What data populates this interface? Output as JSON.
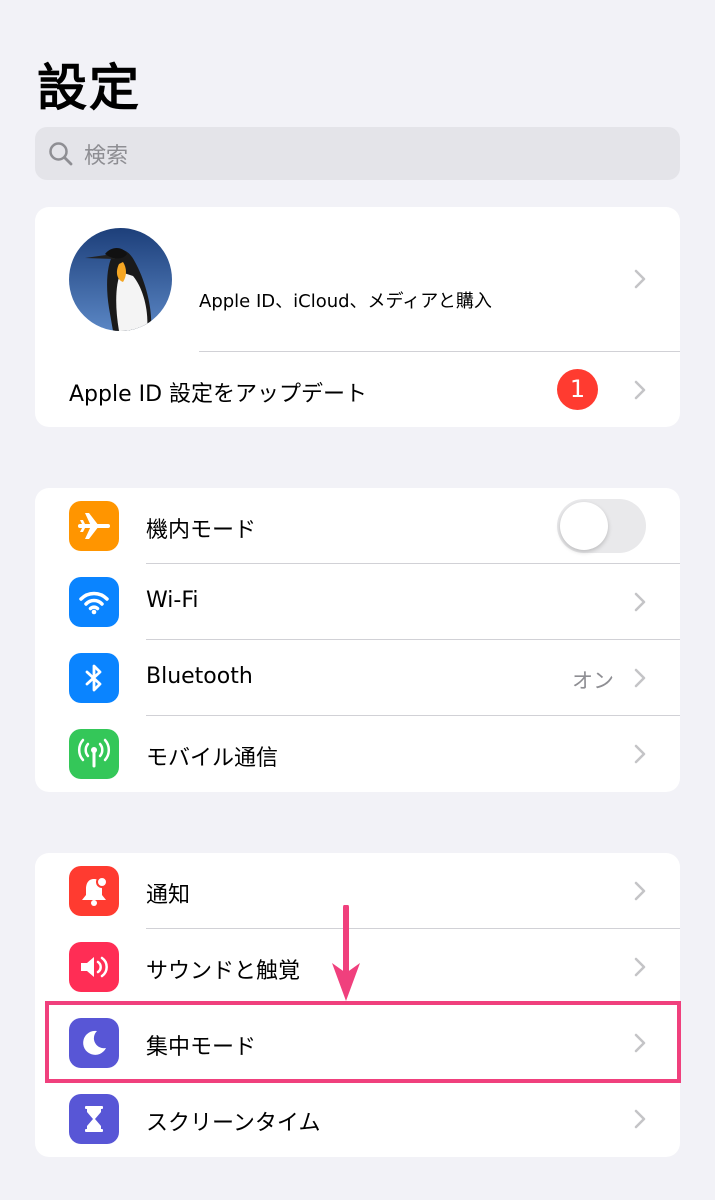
{
  "page": {
    "title": "設定"
  },
  "search": {
    "placeholder": "検索",
    "icon": "search-icon"
  },
  "profile": {
    "subtitle": "Apple ID、iCloud、メディアと購入",
    "update_label": "Apple ID 設定をアップデート",
    "badge_count": "1"
  },
  "network": {
    "items": [
      {
        "label": "機内モード",
        "icon": "airplane-icon",
        "color": "#ff9500",
        "toggle_on": false
      },
      {
        "label": "Wi-Fi",
        "icon": "wifi-icon",
        "color": "#0a84ff",
        "value": ""
      },
      {
        "label": "Bluetooth",
        "icon": "bluetooth-icon",
        "color": "#0a84ff",
        "value": "オン"
      },
      {
        "label": "モバイル通信",
        "icon": "antenna-icon",
        "color": "#34c759",
        "value": ""
      }
    ]
  },
  "notify": {
    "items": [
      {
        "label": "通知",
        "icon": "bell-icon",
        "color": "#ff3b30"
      },
      {
        "label": "サウンドと触覚",
        "icon": "speaker-icon",
        "color": "#ff2d55"
      },
      {
        "label": "集中モード",
        "icon": "moon-icon",
        "color": "#5856d6"
      },
      {
        "label": "スクリーンタイム",
        "icon": "hourglass-icon",
        "color": "#5856d6"
      }
    ]
  },
  "annotation": {
    "highlight_color": "#f0407d"
  }
}
